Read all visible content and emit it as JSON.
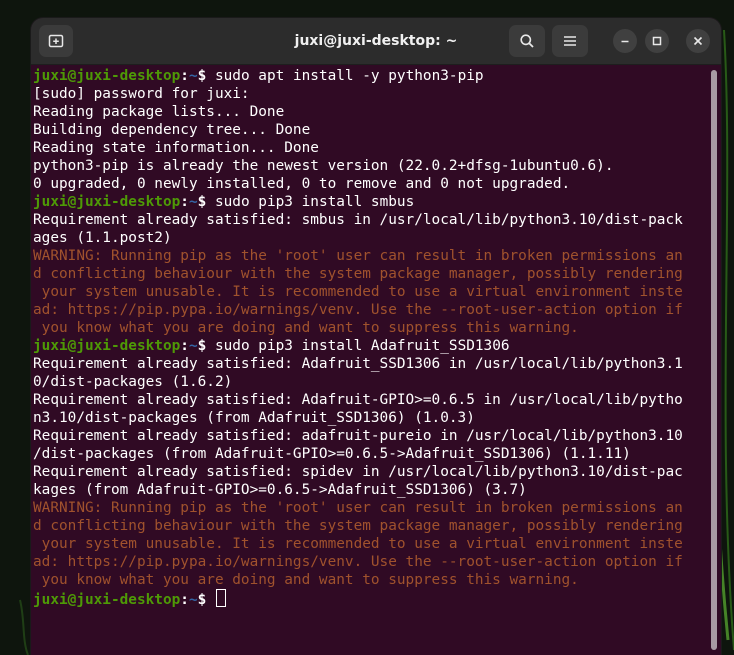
{
  "window": {
    "title": "juxi@juxi-desktop: ~",
    "icons": {
      "new_tab": "new-tab-icon",
      "search": "search-icon",
      "menu": "hamburger-menu-icon",
      "minimize": "minimize-icon",
      "maximize": "maximize-icon",
      "close": "close-icon"
    }
  },
  "colors": {
    "terminal_bg": "#300a24",
    "prompt_user": "#4e9a06",
    "prompt_path": "#3465a4",
    "warning_text": "#a0522d",
    "titlebar_bg": "#2c2c2c"
  },
  "terminal": {
    "lines": [
      {
        "type": "prompt",
        "user": "juxi@juxi-desktop",
        "sep": ":",
        "path": "~",
        "sym": "$",
        "cmd": " sudo apt install -y python3-pip"
      },
      {
        "type": "out",
        "text": "[sudo] password for juxi:"
      },
      {
        "type": "out",
        "text": "Reading package lists... Done"
      },
      {
        "type": "out",
        "text": "Building dependency tree... Done"
      },
      {
        "type": "out",
        "text": "Reading state information... Done"
      },
      {
        "type": "out",
        "text": "python3-pip is already the newest version (22.0.2+dfsg-1ubuntu0.6)."
      },
      {
        "type": "out",
        "text": "0 upgraded, 0 newly installed, 0 to remove and 0 not upgraded."
      },
      {
        "type": "prompt",
        "user": "juxi@juxi-desktop",
        "sep": ":",
        "path": "~",
        "sym": "$",
        "cmd": " sudo pip3 install smbus"
      },
      {
        "type": "out",
        "text": "Requirement already satisfied: smbus in /usr/local/lib/python3.10/dist-pack"
      },
      {
        "type": "out",
        "text": "ages (1.1.post2)"
      },
      {
        "type": "warn",
        "text": "WARNING: Running pip as the 'root' user can result in broken permissions an"
      },
      {
        "type": "warn",
        "text": "d conflicting behaviour with the system package manager, possibly rendering"
      },
      {
        "type": "warn",
        "text": " your system unusable. It is recommended to use a virtual environment inste"
      },
      {
        "type": "warn",
        "text": "ad: https://pip.pypa.io/warnings/venv. Use the --root-user-action option if"
      },
      {
        "type": "warn",
        "text": " you know what you are doing and want to suppress this warning."
      },
      {
        "type": "prompt",
        "user": "juxi@juxi-desktop",
        "sep": ":",
        "path": "~",
        "sym": "$",
        "cmd": " sudo pip3 install Adafruit_SSD1306"
      },
      {
        "type": "out",
        "text": "Requirement already satisfied: Adafruit_SSD1306 in /usr/local/lib/python3.1"
      },
      {
        "type": "out",
        "text": "0/dist-packages (1.6.2)"
      },
      {
        "type": "out",
        "text": "Requirement already satisfied: Adafruit-GPIO>=0.6.5 in /usr/local/lib/pytho"
      },
      {
        "type": "out",
        "text": "n3.10/dist-packages (from Adafruit_SSD1306) (1.0.3)"
      },
      {
        "type": "out",
        "text": "Requirement already satisfied: adafruit-pureio in /usr/local/lib/python3.10"
      },
      {
        "type": "out",
        "text": "/dist-packages (from Adafruit-GPIO>=0.6.5->Adafruit_SSD1306) (1.1.11)"
      },
      {
        "type": "out",
        "text": "Requirement already satisfied: spidev in /usr/local/lib/python3.10/dist-pac"
      },
      {
        "type": "out",
        "text": "kages (from Adafruit-GPIO>=0.6.5->Adafruit_SSD1306) (3.7)"
      },
      {
        "type": "warn",
        "text": "WARNING: Running pip as the 'root' user can result in broken permissions an"
      },
      {
        "type": "warn",
        "text": "d conflicting behaviour with the system package manager, possibly rendering"
      },
      {
        "type": "warn",
        "text": " your system unusable. It is recommended to use a virtual environment inste"
      },
      {
        "type": "warn",
        "text": "ad: https://pip.pypa.io/warnings/venv. Use the --root-user-action option if"
      },
      {
        "type": "warn",
        "text": " you know what you are doing and want to suppress this warning."
      },
      {
        "type": "prompt",
        "user": "juxi@juxi-desktop",
        "sep": ":",
        "path": "~",
        "sym": "$",
        "cmd": " ",
        "cursor": true
      }
    ]
  }
}
